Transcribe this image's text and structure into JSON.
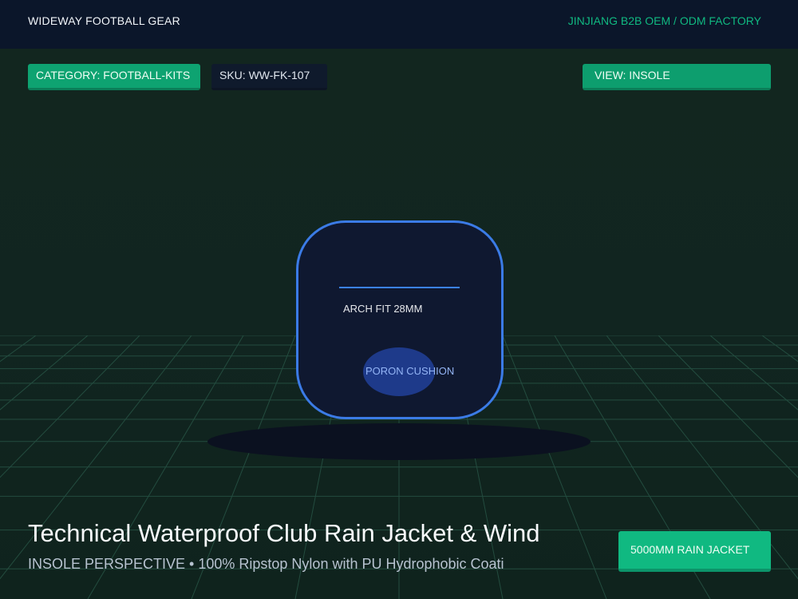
{
  "header": {
    "brand": "WIDEWAY FOOTBALL GEAR",
    "factory": "JINJIANG B2B OEM / ODM FACTORY"
  },
  "tags": {
    "category": "CATEGORY: FOOTBALL-KITS",
    "sku": "SKU: WW-FK-107",
    "view": "VIEW: INSOLE"
  },
  "product_view": {
    "arch_label": "ARCH FIT 28MM",
    "cushion_label": "PORON CUSHION"
  },
  "product": {
    "title": "Technical Waterproof Club Rain Jacket & Wind",
    "subtitle": "INSOLE PERSPECTIVE • 100% Ripstop Nylon with PU Hydrophobic Coati"
  },
  "cta": {
    "label": "5000MM RAIN JACKET"
  },
  "colors": {
    "header_bg": "#0b162a",
    "stage_bg": "#12241f",
    "accent_green": "#10b981",
    "accent_blue": "#3b82f6",
    "grid": "#2a5a4a"
  }
}
